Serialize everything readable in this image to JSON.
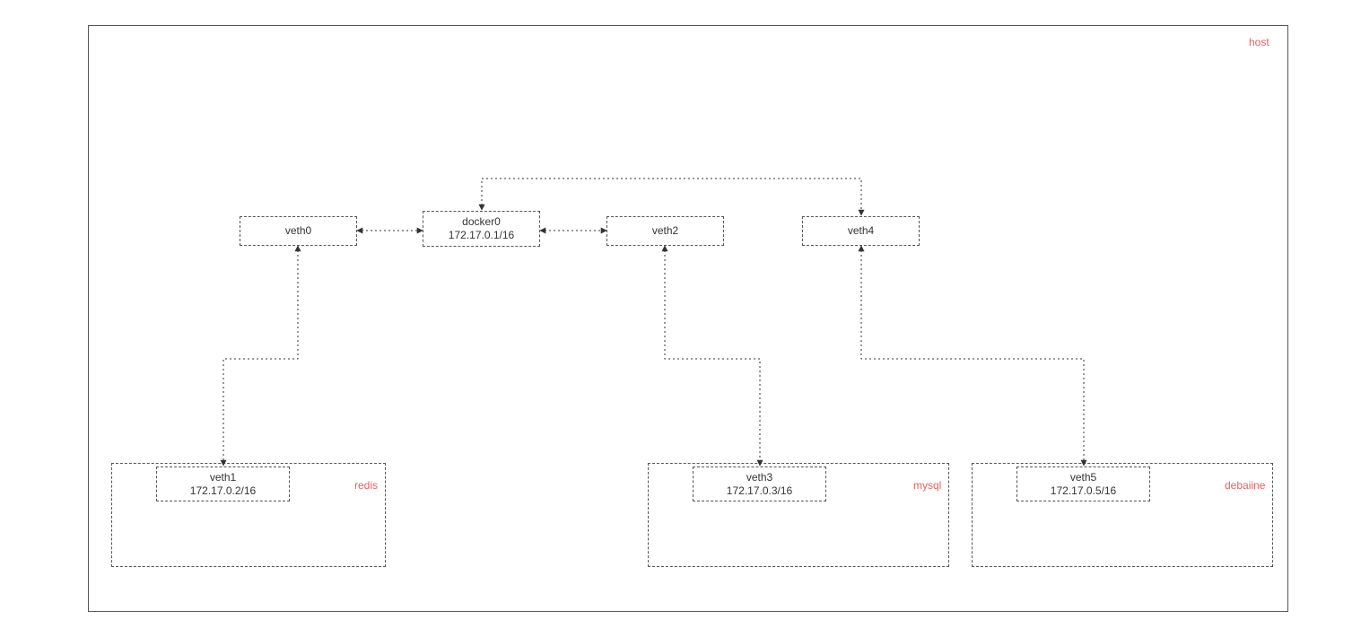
{
  "host": {
    "label": "host"
  },
  "bridge": {
    "name": "docker0",
    "ip": "172.17.0.1/16"
  },
  "veths_host": {
    "v0": "veth0",
    "v2": "veth2",
    "v4": "veth4"
  },
  "containers": {
    "redis": {
      "label": "redis",
      "iface": "veth1",
      "ip": "172.17.0.2/16"
    },
    "mysql": {
      "label": "mysql",
      "iface": "veth3",
      "ip": "172.17.0.3/16"
    },
    "debaiine": {
      "label": "debaiine",
      "iface": "veth5",
      "ip": "172.17.0.5/16"
    }
  }
}
